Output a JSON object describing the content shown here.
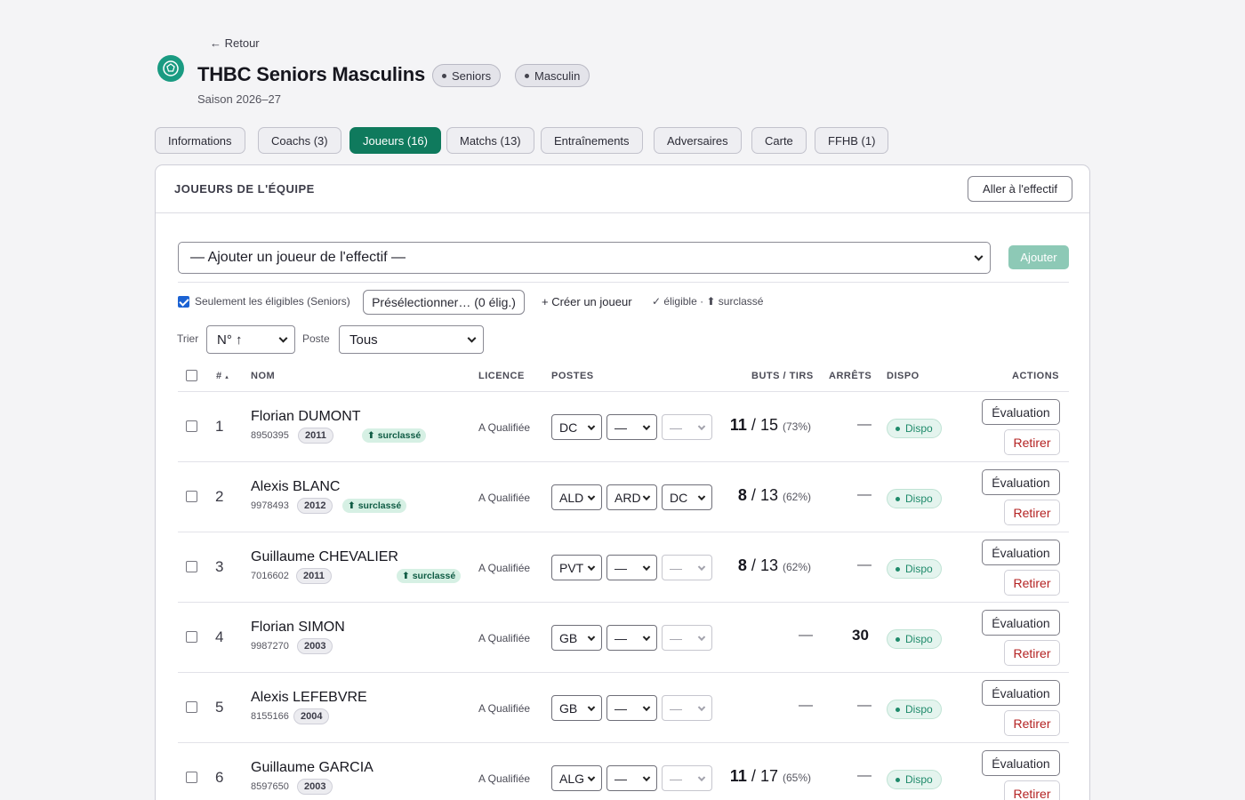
{
  "nav": {
    "back": "← Retour"
  },
  "team": {
    "title": "THBC Seniors Masculins",
    "badges": [
      "Seniors",
      "Masculin"
    ],
    "season": "Saison 2026–27",
    "accent": "#0f7a5d"
  },
  "tabs": [
    {
      "label": "Informations",
      "active": false
    },
    {
      "label": "Coachs (3)",
      "active": false
    },
    {
      "label": "Joueurs (16)",
      "active": true
    },
    {
      "label": "Matchs (13)",
      "active": false
    },
    {
      "label": "Entraînements",
      "active": false
    },
    {
      "label": "Adversaires",
      "active": false
    },
    {
      "label": "Carte",
      "active": false
    },
    {
      "label": "FFHB (1)",
      "active": false
    }
  ],
  "panel": {
    "title": "JOUEURS DE L'ÉQUIPE",
    "goto_label": "Aller à l'effectif",
    "add_select": "— Ajouter un joueur de l'effectif —",
    "add_button": "Ajouter",
    "eligible_only": "Seulement les éligibles (Seniors)",
    "eligible_checked": true,
    "preselect": "Présélectionner… (0 élig.)",
    "create_player": "+ Créer un joueur",
    "legend": "✓ éligible · ⬆ surclassé",
    "sort_label": "Trier",
    "sort_value": "N° ↑",
    "poste_label": "Poste",
    "poste_value": "Tous"
  },
  "table": {
    "headers": {
      "num": "#",
      "num_sort": "▴",
      "name": "NOM",
      "licence": "LICENCE",
      "postes": "POSTES",
      "buts": "BUTS / TIRS",
      "arrets": "ARRÊTS",
      "dispo": "DISPO",
      "actions": "ACTIONS"
    },
    "rows": [
      {
        "num": "1",
        "name": "Florian DUMONT",
        "licence": "8950395",
        "year": "2011",
        "surclasse": "⬆ surclassé",
        "qual": "A  Qualifiée",
        "p1": "DC",
        "p2": "—",
        "p3": "—",
        "goals": "11",
        "shots": "15",
        "pct": "(73%)",
        "arrets": "—",
        "dispo": "Dispo",
        "eval": "Évaluation",
        "retirer": "Retirer"
      },
      {
        "num": "2",
        "name": "Alexis BLANC",
        "licence": "9978493",
        "year": "2012",
        "surclasse": "⬆ surclassé",
        "qual": "A  Qualifiée",
        "p1": "ALD",
        "p2": "ARD",
        "p3": "DC",
        "goals": "8",
        "shots": "13",
        "pct": "(62%)",
        "arrets": "—",
        "dispo": "Dispo",
        "eval": "Évaluation",
        "retirer": "Retirer"
      },
      {
        "num": "3",
        "name": "Guillaume CHEVALIER",
        "licence": "7016602",
        "year": "2011",
        "surclasse": "⬆ surclassé",
        "qual": "A  Qualifiée",
        "p1": "PVT",
        "p2": "—",
        "p3": "—",
        "goals": "8",
        "shots": "13",
        "pct": "(62%)",
        "arrets": "—",
        "dispo": "Dispo",
        "eval": "Évaluation",
        "retirer": "Retirer"
      },
      {
        "num": "4",
        "name": "Florian SIMON",
        "licence": "9987270",
        "year": "2003",
        "surclasse": "",
        "qual": "A  Qualifiée",
        "p1": "GB",
        "p2": "—",
        "p3": "—",
        "goals": "",
        "shots": "",
        "pct": "",
        "buts_empty": "—",
        "arrets": "30",
        "dispo": "Dispo",
        "eval": "Évaluation",
        "retirer": "Retirer"
      },
      {
        "num": "5",
        "name": "Alexis LEFEBVRE",
        "licence": "8155166",
        "year": "2004",
        "surclasse": "",
        "qual": "A  Qualifiée",
        "p1": "GB",
        "p2": "—",
        "p3": "—",
        "goals": "",
        "shots": "",
        "pct": "",
        "buts_empty": "—",
        "arrets": "—",
        "dispo": "Dispo",
        "eval": "Évaluation",
        "retirer": "Retirer"
      },
      {
        "num": "6",
        "name": "Guillaume GARCIA",
        "licence": "8597650",
        "year": "2003",
        "surclasse": "",
        "qual": "A  Qualifiée",
        "p1": "ALG",
        "p2": "—",
        "p3": "—",
        "goals": "11",
        "shots": "17",
        "pct": "(65%)",
        "arrets": "—",
        "dispo": "Dispo",
        "eval": "Évaluation",
        "retirer": "Retirer"
      }
    ]
  }
}
